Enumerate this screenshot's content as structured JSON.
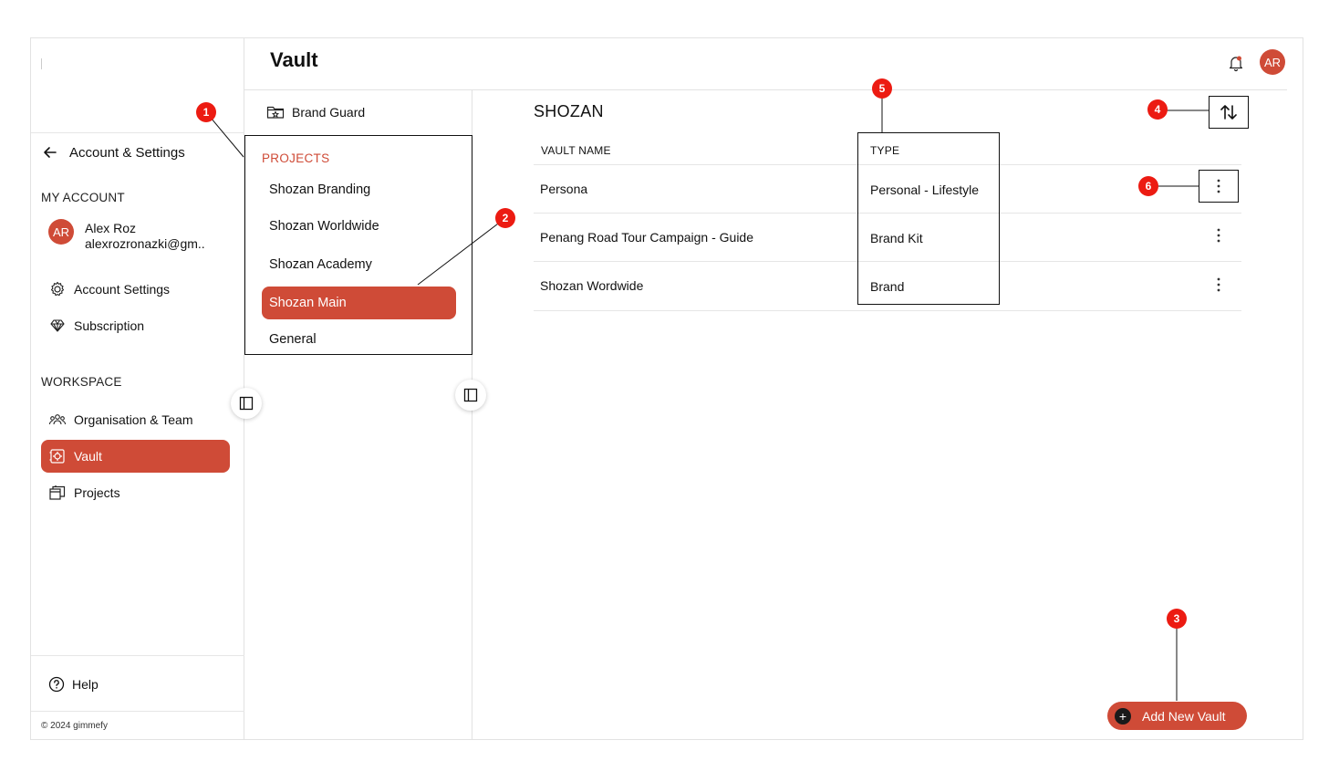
{
  "sidebar": {
    "back_label": "Account & Settings",
    "my_account_label": "MY ACCOUNT",
    "user": {
      "initials": "AR",
      "name": "Alex Roz",
      "email": "alexrozronazki@gm.."
    },
    "account_items": [
      {
        "label": "Account Settings",
        "icon": "gear-icon"
      },
      {
        "label": "Subscription",
        "icon": "diamond-icon"
      }
    ],
    "workspace_label": "WORKSPACE",
    "workspace_items": [
      {
        "label": "Organisation & Team",
        "icon": "team-icon",
        "active": false
      },
      {
        "label": "Vault",
        "icon": "vault-icon",
        "active": true
      },
      {
        "label": "Projects",
        "icon": "projects-icon",
        "active": false
      }
    ],
    "help_label": "Help",
    "copyright": "© 2024 gimmefy"
  },
  "header": {
    "title": "Vault",
    "avatar_initials": "AR"
  },
  "middle": {
    "brand_guard_label": "Brand Guard",
    "projects_label": "PROJECTS",
    "projects": [
      {
        "label": "Shozan Branding",
        "active": false
      },
      {
        "label": "Shozan Worldwide",
        "active": false
      },
      {
        "label": "Shozan Academy",
        "active": false
      },
      {
        "label": "Shozan Main",
        "active": true
      },
      {
        "label": "General",
        "active": false
      }
    ]
  },
  "main": {
    "title": "SHOZAN",
    "columns": {
      "name": "VAULT NAME",
      "type": "TYPE"
    },
    "rows": [
      {
        "name": "Persona",
        "type": "Personal - Lifestyle"
      },
      {
        "name": "Penang Road Tour Campaign - Guide",
        "type": "Brand Kit"
      },
      {
        "name": "Shozan Wordwide",
        "type": "Brand"
      }
    ],
    "add_button_label": "Add New Vault"
  },
  "annotations": [
    "1",
    "2",
    "3",
    "4",
    "5",
    "6"
  ],
  "colors": {
    "accent": "#cf4b37",
    "annotation": "#ec1b12"
  }
}
